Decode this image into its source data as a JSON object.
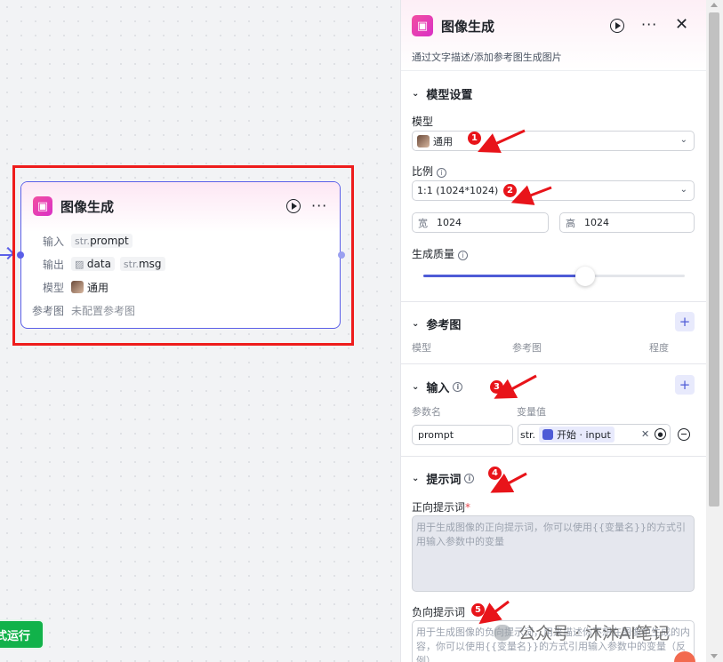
{
  "node": {
    "title": "图像生成",
    "rows": {
      "input_label": "输入",
      "input_tag_prefix": "str.",
      "input_tag_name": "prompt",
      "output_label": "输出",
      "output_tag1_name": "data",
      "output_tag2_prefix": "str.",
      "output_tag2_name": "msg",
      "model_label": "模型",
      "model_value": "通用",
      "ref_label": "参考图",
      "ref_value": "未配置参考图"
    }
  },
  "run_button": {
    "label": "试运行",
    "visible_label": "式运行"
  },
  "panel": {
    "title": "图像生成",
    "description": "通过文字描述/添加参考图生成图片",
    "model_section": {
      "title": "模型设置",
      "model_label": "模型",
      "model_value": "通用",
      "ratio_label": "比例",
      "ratio_value": "1:1 (1024*1024)",
      "width_prefix": "宽",
      "width_value": "1024",
      "height_prefix": "高",
      "height_value": "1024",
      "quality_label": "生成质量",
      "quality_level": 0.62
    },
    "ref_section": {
      "title": "参考图",
      "columns": [
        "模型",
        "参考图",
        "程度"
      ]
    },
    "input_section": {
      "title": "输入",
      "col_param": "参数名",
      "col_value": "变量值",
      "param_name": "prompt",
      "value_prefix": "str.",
      "value_chip": "开始 · input"
    },
    "prompt_section": {
      "title": "提示词",
      "positive_label": "正向提示词",
      "required_mark": "*",
      "positive_placeholder": "用于生成图像的正向提示词，你可以使用{{变量名}}的方式引用输入参数中的变量",
      "negative_label": "负向提示词",
      "negative_placeholder": "用于生成图像的负向提示词，用来描述你不想在图像中生成的内容，你可以使用{{变量名}}的方式引用输入参数中的变量（反例）"
    }
  },
  "annotations": [
    "1",
    "2",
    "3",
    "4",
    "5"
  ],
  "watermark": "公众号 · 沐沐AI笔记",
  "colors": {
    "accent": "#4e5bd6",
    "highlight": "#ee1c1c",
    "run_green": "#11b24a",
    "annotation_red": "#e8141a"
  }
}
